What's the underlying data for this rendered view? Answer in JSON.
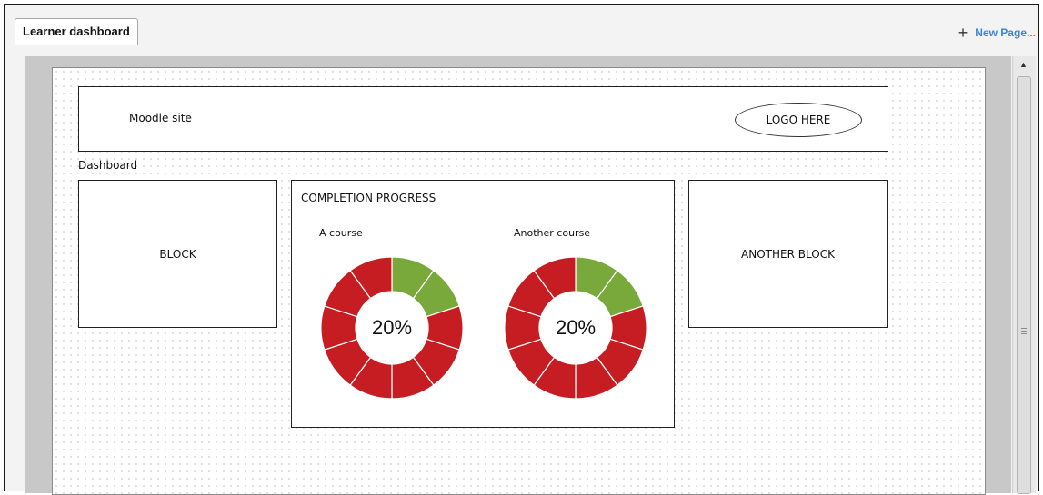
{
  "tabs": {
    "active_label": "Learner dashboard"
  },
  "toolbar": {
    "new_page_label": "New Page...",
    "new_page_icon": "plus-icon"
  },
  "header": {
    "site_name": "Moodle site",
    "logo_text": "LOGO HERE"
  },
  "page": {
    "dashboard_label": "Dashboard"
  },
  "blocks": {
    "left_title": "BLOCK",
    "right_title": "ANOTHER BLOCK"
  },
  "progress": {
    "title": "COMPLETION PROGRESS",
    "courses": [
      {
        "name": "A course",
        "percent_label": "20%",
        "completed_segments": 2,
        "total_segments": 10
      },
      {
        "name": "Another course",
        "percent_label": "20%",
        "completed_segments": 2,
        "total_segments": 10
      }
    ],
    "colors": {
      "complete": "#78a93a",
      "incomplete": "#c61d23"
    }
  }
}
